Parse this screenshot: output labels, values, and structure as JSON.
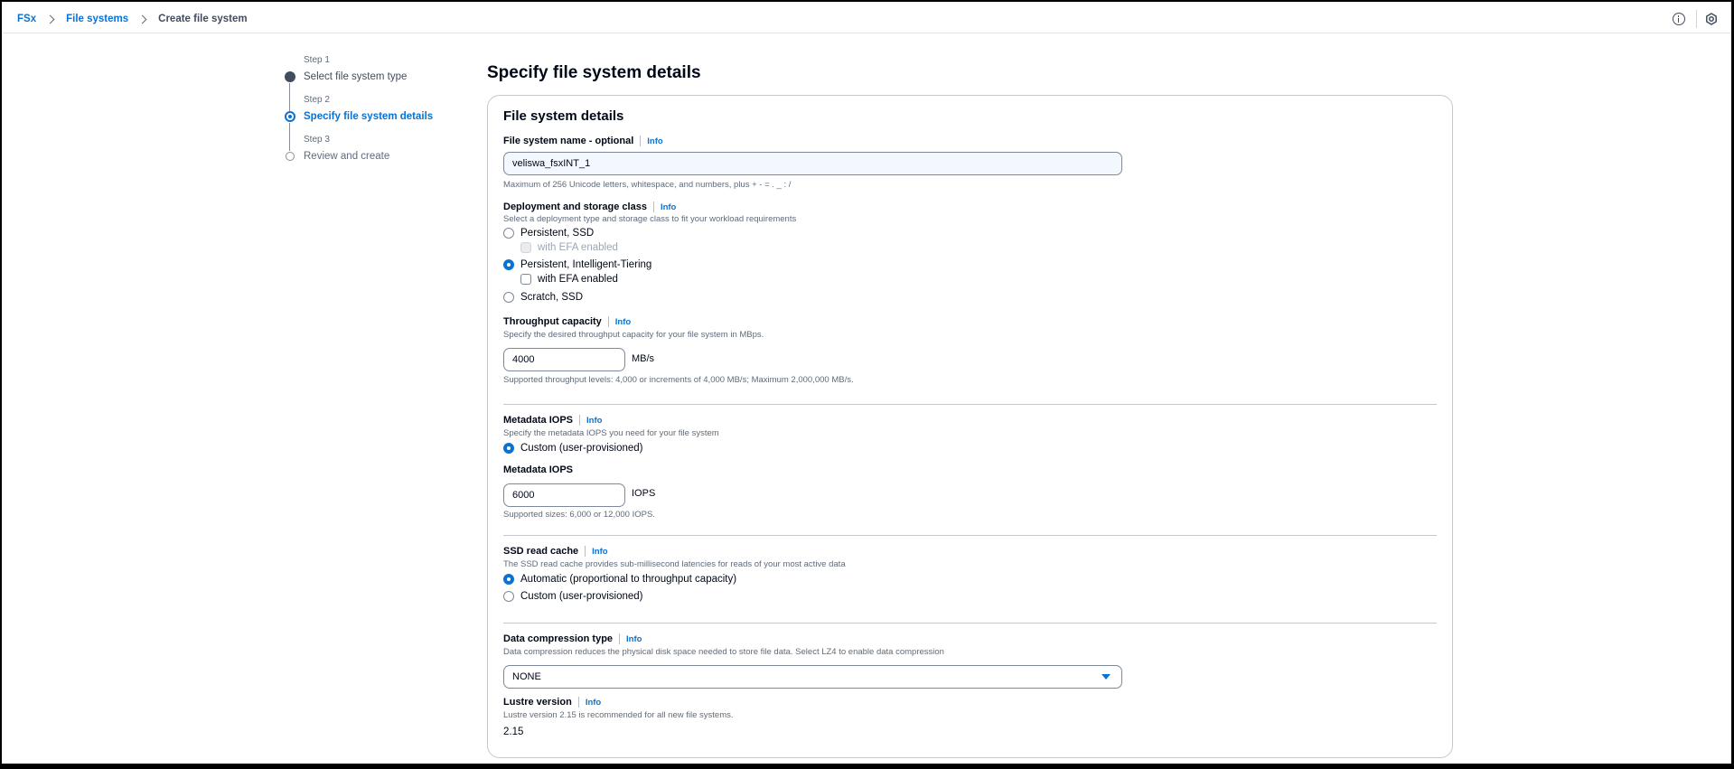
{
  "breadcrumb": {
    "items": [
      "FSx",
      "File systems"
    ],
    "current": "Create file system"
  },
  "steps": [
    {
      "number": "Step 1",
      "title": "Select file system type"
    },
    {
      "number": "Step 2",
      "title": "Specify file system details"
    },
    {
      "number": "Step 3",
      "title": "Review and create"
    }
  ],
  "page_title": "Specify file system details",
  "container_title": "File system details",
  "info_label": "Info",
  "fs_name": {
    "label": "File system name - optional",
    "value": "veliswa_fsxINT_1",
    "hint": "Maximum of 256 Unicode letters, whitespace, and numbers, plus + - = . _ : /"
  },
  "deployment": {
    "label": "Deployment and storage class",
    "desc": "Select a deployment type and storage class to fit your workload requirements",
    "options": [
      "Persistent, SSD",
      "Persistent, Intelligent-Tiering",
      "Scratch, SSD"
    ],
    "efa_label": "with EFA enabled",
    "selected": "Persistent, Intelligent-Tiering"
  },
  "throughput": {
    "label": "Throughput capacity",
    "desc": "Specify the desired throughput capacity for your file system in MBps.",
    "value": "4000",
    "unit": "MB/s",
    "hint": "Supported throughput levels: 4,000 or increments of 4,000 MB/s; Maximum 2,000,000 MB/s."
  },
  "metadata": {
    "label": "Metadata IOPS",
    "desc": "Specify the metadata IOPS you need for your file system",
    "option": "Custom (user-provisioned)",
    "sub_label": "Metadata IOPS",
    "value": "6000",
    "unit": "IOPS",
    "hint": "Supported sizes: 6,000 or 12,000 IOPS."
  },
  "ssd_cache": {
    "label": "SSD read cache",
    "desc": "The SSD read cache provides sub-millisecond latencies for reads of your most active data",
    "options": [
      "Automatic (proportional to throughput capacity)",
      "Custom (user-provisioned)"
    ],
    "selected": "Automatic (proportional to throughput capacity)"
  },
  "compression": {
    "label": "Data compression type",
    "desc": "Data compression reduces the physical disk space needed to store file data. Select LZ4 to enable data compression",
    "value": "NONE"
  },
  "lustre": {
    "label": "Lustre version",
    "desc": "Lustre version 2.15 is recommended for all new file systems.",
    "value": "2.15"
  },
  "colors": {
    "accent": "#0972d3",
    "text": "#000716",
    "muted": "#5f6b7a"
  }
}
